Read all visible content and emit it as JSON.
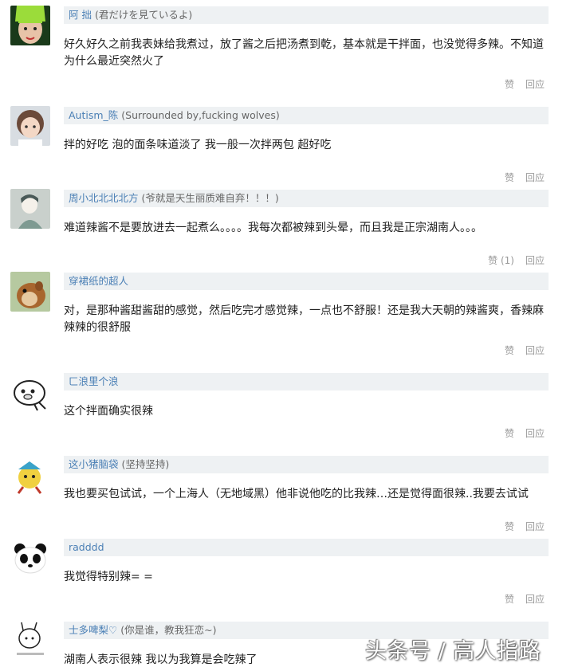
{
  "comments": [
    {
      "username": "阿 拙",
      "signature": "(君だけを見ているよ)",
      "text": "好久好久之前我表妹给我煮过，放了酱之后把汤煮到乾，基本就是干拌面，也没觉得多辣。不知道为什么最近突然火了",
      "like": "赞",
      "reply": "回应"
    },
    {
      "username": "Autism_陈",
      "signature": "(Surrounded by,fucking wolves)",
      "text": "拌的好吃 泡的面条味道淡了 我一般一次拌两包 超好吃",
      "like": "赞",
      "reply": "回应"
    },
    {
      "username": "周小北北北北方",
      "signature": "(爷就是天生丽质难自弃！！！)",
      "text": "难道辣酱不是要放进去一起煮么。。。。我每次都被辣到头晕，而且我是正宗湖南人。。。",
      "like": "赞 (1)",
      "reply": "回应"
    },
    {
      "username": "穿裙纸的超人",
      "signature": "",
      "text": "对，是那种酱甜酱甜的感觉，然后吃完才感觉辣，一点也不舒服！还是我大天朝的辣酱爽，香辣麻辣辣的很舒服",
      "like": "赞",
      "reply": "回应"
    },
    {
      "username": "ㄈ浪里个浪",
      "signature": "",
      "text": "这个拌面确实很辣",
      "like": "赞",
      "reply": "回应"
    },
    {
      "username": "这小猪脑袋",
      "signature": "(坚持坚持)",
      "text": "我也要买包试试，一个上海人（无地域黑）他非说他吃的比我辣…还是觉得面很辣..我要去试试",
      "like": "赞",
      "reply": "回应"
    },
    {
      "username": "radddd",
      "signature": "",
      "text": "我觉得特别辣= =",
      "like": "赞",
      "reply": "回应"
    },
    {
      "username": "士多啤梨♡",
      "signature": "(你是谁，教我狂恋~)",
      "text": "湖南人表示很辣 我以为我算是会吃辣了",
      "like": "",
      "reply": ""
    }
  ],
  "watermark": "头条号 / 高人指路",
  "colors": {
    "username": "#4a7fb5",
    "header_bg": "#eef1f3",
    "action": "#9a9a9a"
  }
}
